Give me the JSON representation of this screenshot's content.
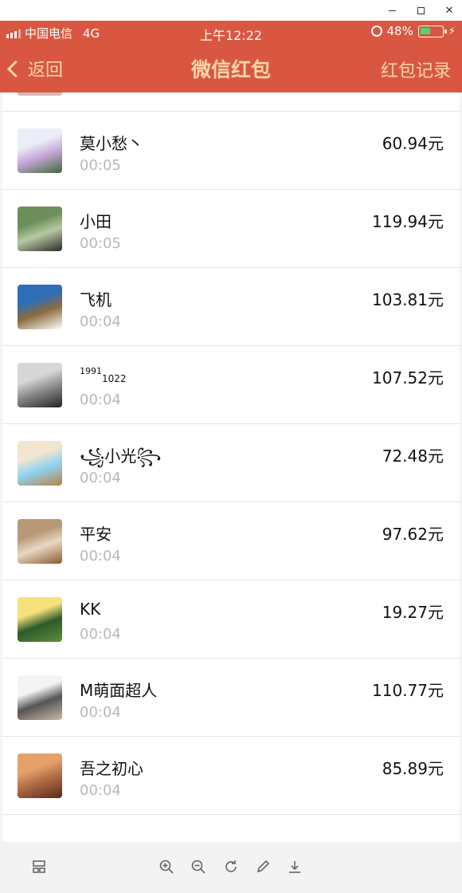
{
  "status_bar": {
    "carrier": "中国电信",
    "network": "4G",
    "time": "上午12:22",
    "battery_percent": "48%",
    "battery_level": 0.48
  },
  "nav": {
    "back_label": "返回",
    "title": "微信红包",
    "record_label": "红包记录"
  },
  "entries": [
    {
      "name": "莫小愁丶",
      "time": "00:05",
      "amount": "60.94元",
      "avatar_icon": "anime-warrior-avatar",
      "colors": [
        "#e9eef7",
        "#3e6b3a",
        "#c7a6d8"
      ]
    },
    {
      "name": "小田",
      "time": "00:05",
      "amount": "119.94元",
      "avatar_icon": "person-outdoor-avatar",
      "colors": [
        "#6c8f5b",
        "#2a2a2a",
        "#b7c9a2"
      ]
    },
    {
      "name": "飞机",
      "time": "00:04",
      "amount": "103.81元",
      "avatar_icon": "sky-landscape-avatar",
      "colors": [
        "#2e6db8",
        "#ffffff",
        "#8a6b3b"
      ]
    },
    {
      "name_sup": "1991",
      "name_sub": "1022",
      "time": "00:04",
      "amount": "107.52元",
      "avatar_icon": "person-backpack-avatar",
      "colors": [
        "#d7d7d9",
        "#222222",
        "#8c8c8c"
      ]
    },
    {
      "name": "꧁小光꧂",
      "time": "00:04",
      "amount": "72.48元",
      "avatar_icon": "anime-boy-avatar",
      "colors": [
        "#f3e6d0",
        "#b88348",
        "#8fd3f0"
      ]
    },
    {
      "name": "平安",
      "time": "00:04",
      "amount": "97.62元",
      "avatar_icon": "cat-avatar",
      "colors": [
        "#b89977",
        "#8a5a2b",
        "#e8d8c3"
      ]
    },
    {
      "name": "KK",
      "time": "00:04",
      "amount": "19.27元",
      "avatar_icon": "sunrise-hills-avatar",
      "colors": [
        "#f5e27a",
        "#5f8f3a",
        "#2e5a2a"
      ]
    },
    {
      "name": "M萌面超人",
      "time": "00:04",
      "amount": "110.77元",
      "avatar_icon": "cartoon-boy-avatar",
      "colors": [
        "#f4f4f2",
        "#c9b9a6",
        "#555555"
      ]
    },
    {
      "name": "吾之初心",
      "time": "00:04",
      "amount": "85.89元",
      "avatar_icon": "portrait-avatar",
      "colors": [
        "#e4a26a",
        "#5a2a1a",
        "#b06b45"
      ]
    }
  ],
  "toolbar": {
    "icons": [
      "layout-icon",
      "zoom-in-icon",
      "zoom-out-icon",
      "rotate-icon",
      "edit-icon",
      "download-icon"
    ]
  }
}
